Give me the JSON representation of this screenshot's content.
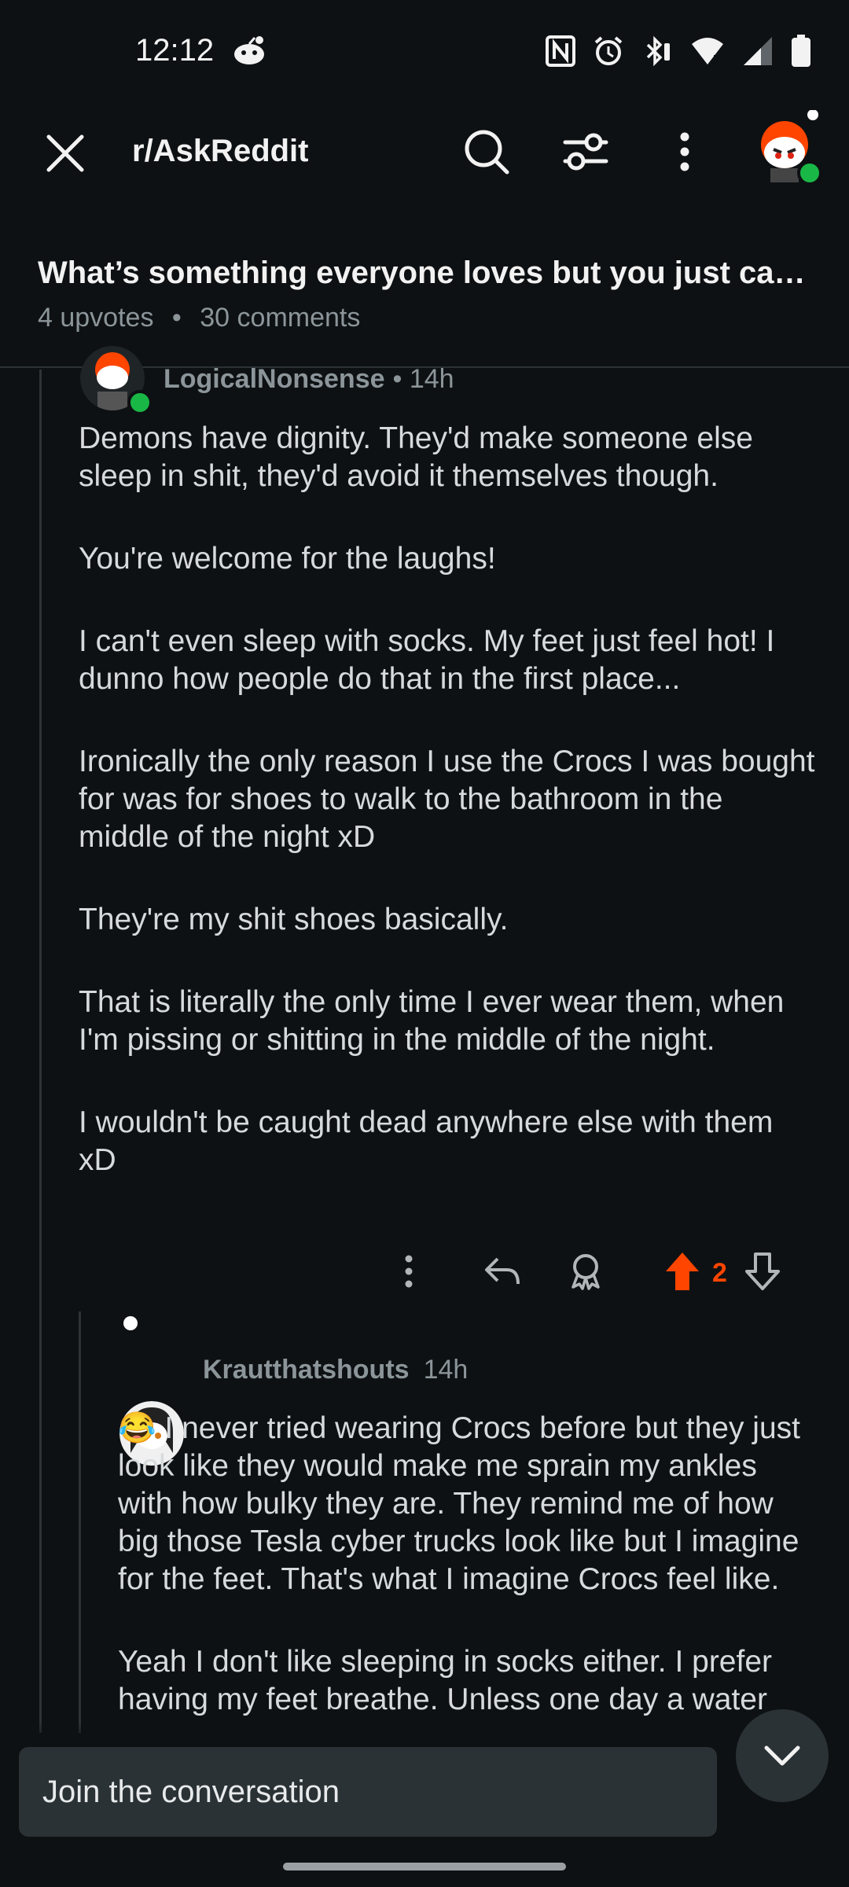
{
  "status_bar": {
    "time": "12:12",
    "icons": [
      "reddit-notification-icon",
      "nfc-icon",
      "alarm-icon",
      "bluetooth-icon",
      "wifi-icon",
      "signal-icon",
      "battery-icon"
    ]
  },
  "header": {
    "subreddit": "r/AskReddit",
    "icons": [
      "close-icon",
      "search-icon",
      "filter-icon",
      "more-icon",
      "profile-avatar"
    ]
  },
  "post": {
    "title": "What’s something everyone loves but you just can’t stand?",
    "upvotes": "4 upvotes",
    "separator": "•",
    "comments": "30 comments"
  },
  "comments": [
    {
      "author": "LogicalNonsense",
      "time": "• 14h",
      "paragraphs": [
        "Demons have dignity. They'd make someone else sleep in shit, they'd avoid it themselves though.",
        "You're welcome for the laughs!",
        "I can't even sleep with socks. My feet just feel hot! I dunno how people do that in the first place...",
        "Ironically the only reason I use the Crocs I was bought for was for shoes to walk to the bathroom in the middle of the night xD",
        "They're my shit shoes basically.",
        "That is literally the only time I ever wear them, when I'm pissing or shitting in the middle of the night.",
        "I wouldn't be caught dead anywhere else with them xD"
      ],
      "votes": "2",
      "upvoted": true
    },
    {
      "author": "Krautthatshouts",
      "time": "14h",
      "emoji": "😂",
      "paragraphs": [
        "I never tried wearing Crocs before but they just look like they would make me sprain my ankles with how bulky they are. They remind me of how big those Tesla cyber trucks look like but I imagine for the feet. That's what I imagine Crocs feel like.",
        "Yeah I don't like sleeping in socks either. I prefer having my feet breathe. Unless one day a water"
      ]
    }
  ],
  "composer": {
    "placeholder": "Join the conversation"
  },
  "colors": {
    "background": "#0e1113",
    "upvote": "#ff4500",
    "online": "#19b846",
    "muted_text": "#8b959a"
  }
}
